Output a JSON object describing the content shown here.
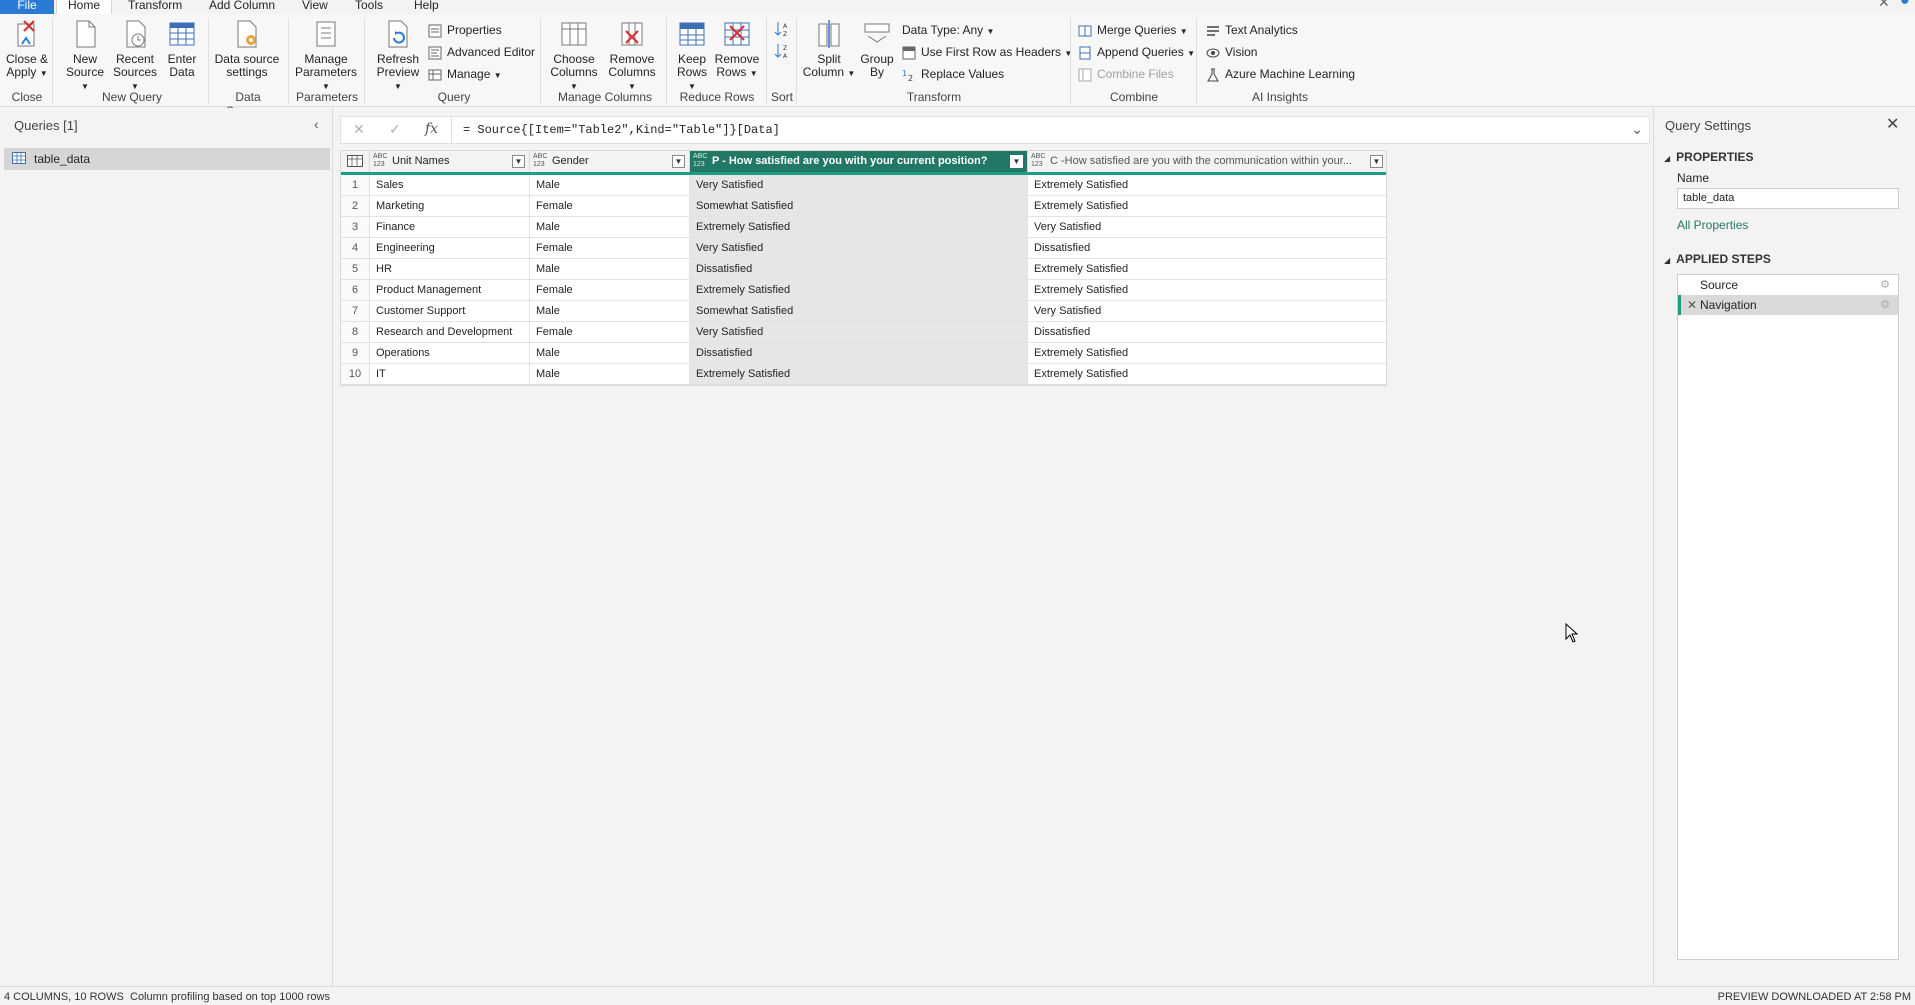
{
  "ribbon": {
    "tabs": [
      {
        "label": "File"
      },
      {
        "label": "Home"
      },
      {
        "label": "Transform"
      },
      {
        "label": "Add Column"
      },
      {
        "label": "View"
      },
      {
        "label": "Tools"
      },
      {
        "label": "Help"
      }
    ],
    "active_tab": "Home",
    "buttons": {
      "close_apply": "Close & Apply",
      "new_source": "New Source",
      "recent_sources": "Recent Sources",
      "enter_data": "Enter Data",
      "data_source_settings": "Data source settings",
      "manage_parameters": "Manage Parameters",
      "refresh_preview": "Refresh Preview",
      "properties": "Properties",
      "advanced_editor": "Advanced Editor",
      "manage": "Manage",
      "choose_columns": "Choose Columns",
      "remove_columns": "Remove Columns",
      "keep_rows": "Keep Rows",
      "remove_rows": "Remove Rows",
      "split_column": "Split Column",
      "group_by": "Group By",
      "data_type": "Data Type: Any",
      "use_first_row": "Use First Row as Headers",
      "replace_values": "Replace Values",
      "merge_queries": "Merge Queries",
      "append_queries": "Append Queries",
      "combine_files": "Combine Files",
      "text_analytics": "Text Analytics",
      "vision": "Vision",
      "azure_ml": "Azure Machine Learning"
    },
    "groups": {
      "close": "Close",
      "new_query": "New Query",
      "data_sources": "Data Sources",
      "parameters": "Parameters",
      "query": "Query",
      "manage_columns": "Manage Columns",
      "reduce_rows": "Reduce Rows",
      "sort": "Sort",
      "transform": "Transform",
      "combine": "Combine",
      "ai_insights": "AI Insights"
    }
  },
  "queries_pane": {
    "title": "Queries [1]",
    "items": [
      {
        "label": "table_data"
      }
    ]
  },
  "formula_bar": {
    "formula": "= Source{[Item=\"Table2\",Kind=\"Table\"]}[Data]"
  },
  "grid": {
    "type_label_top": "ABC",
    "type_label_bottom": "123",
    "columns": [
      {
        "header": "Unit Names"
      },
      {
        "header": "Gender"
      },
      {
        "header": "P - How satisfied are you with your current position?"
      },
      {
        "header": "C -How satisfied are you with the communication within your..."
      }
    ],
    "selected_column_index": 2,
    "rows": [
      {
        "n": "1",
        "cells": [
          "Sales",
          "Male",
          "Very Satisfied",
          "Extremely Satisfied"
        ]
      },
      {
        "n": "2",
        "cells": [
          "Marketing",
          "Female",
          "Somewhat Satisfied",
          "Extremely Satisfied"
        ]
      },
      {
        "n": "3",
        "cells": [
          "Finance",
          "Male",
          "Extremely Satisfied",
          "Very Satisfied"
        ]
      },
      {
        "n": "4",
        "cells": [
          "Engineering",
          "Female",
          "Very Satisfied",
          "Dissatisfied"
        ]
      },
      {
        "n": "5",
        "cells": [
          "HR",
          "Male",
          "Dissatisfied",
          "Extremely Satisfied"
        ]
      },
      {
        "n": "6",
        "cells": [
          "Product Management",
          "Female",
          "Extremely Satisfied",
          "Extremely Satisfied"
        ]
      },
      {
        "n": "7",
        "cells": [
          "Customer Support",
          "Male",
          "Somewhat Satisfied",
          "Very Satisfied"
        ]
      },
      {
        "n": "8",
        "cells": [
          "Research and Development",
          "Female",
          "Very Satisfied",
          "Dissatisfied"
        ]
      },
      {
        "n": "9",
        "cells": [
          "Operations",
          "Male",
          "Dissatisfied",
          "Extremely Satisfied"
        ]
      },
      {
        "n": "10",
        "cells": [
          "IT",
          "Male",
          "Extremely Satisfied",
          "Extremely Satisfied"
        ]
      }
    ]
  },
  "settings_pane": {
    "title": "Query Settings",
    "properties_heading": "PROPERTIES",
    "name_label": "Name",
    "name_value": "table_data",
    "all_properties": "All Properties",
    "steps_heading": "APPLIED STEPS",
    "steps": [
      {
        "label": "Source"
      },
      {
        "label": "Navigation"
      }
    ],
    "active_step": "Navigation"
  },
  "status_bar": {
    "counts": "4 COLUMNS, 10 ROWS",
    "profiling": "Column profiling based on top 1000 rows",
    "preview": "PREVIEW DOWNLOADED AT 2:58 PM"
  },
  "colors": {
    "accent": "#217867",
    "accent_bright": "#1e9e86",
    "file_tab": "#2b7bd6"
  }
}
